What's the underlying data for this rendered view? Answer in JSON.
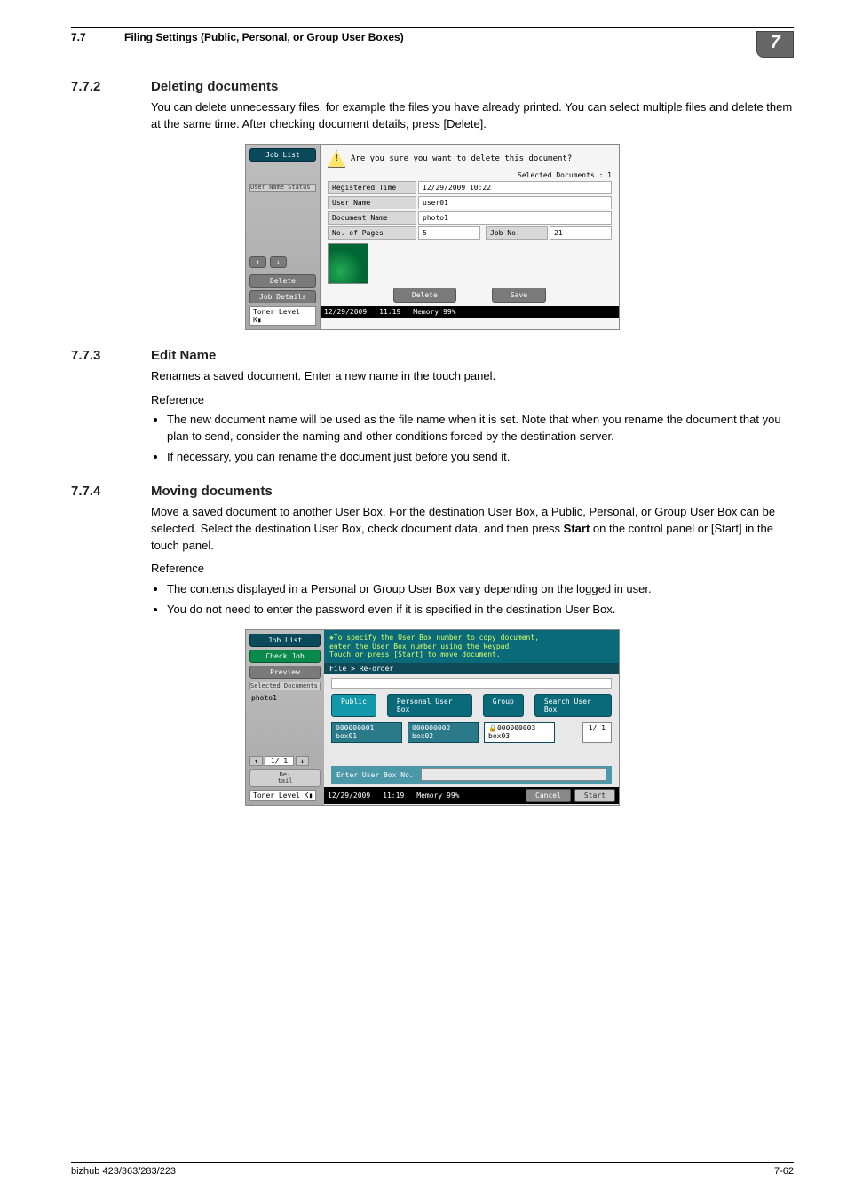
{
  "header": {
    "num": "7.7",
    "title": "Filing Settings (Public, Personal, or Group User Boxes)",
    "chapter": "7"
  },
  "s772": {
    "num": "7.7.2",
    "title": "Deleting documents",
    "para": "You can delete unnecessary files, for example the files you have already printed. You can select multiple files and delete them at the same time. After checking document details, press [Delete]."
  },
  "shot1": {
    "jobList": "Job List",
    "confirm": "Are you sure you want to delete this document?",
    "selDocsLabel": "Selected Documents",
    "selDocsVal": ":   1",
    "userStatus": "User Name   Status",
    "rows": {
      "regTimeLabel": "Registered Time",
      "regTimeVal": "12/29/2009   10:22",
      "userLabel": "User Name",
      "userVal": "user01",
      "docLabel": "Document Name",
      "docVal": "photo1",
      "pagesLabel": "No. of Pages",
      "pagesVal": "5",
      "jobNoLabel": "Job No.",
      "jobNoVal": "21"
    },
    "arrowUp": "↑",
    "arrowDown": "↓",
    "sideDelete": "Delete",
    "sideJobDetails": "Job Details",
    "btnDelete": "Delete",
    "btnSave": "Save",
    "toner": "Toner Level  K▮",
    "status": {
      "date": "12/29/2009",
      "time": "11:19",
      "memLabel": "Memory",
      "memVal": "99%"
    }
  },
  "s773": {
    "num": "7.7.3",
    "title": "Edit Name",
    "para": "Renames a saved document. Enter a new name in the touch panel.",
    "ref": "Reference",
    "b1": "The new document name will be used as the file name when it is set. Note that when you rename the document that you plan to send, consider the naming and other conditions forced by the destination server.",
    "b2": "If necessary, you can rename the document just before you send it."
  },
  "s774": {
    "num": "7.7.4",
    "title": "Moving documents",
    "para1": "Move a saved document to another User Box. For the destination User Box, a Public, Personal, or Group User Box can be selected. Select the destination User Box, check document data, and then press ",
    "paraBold": "Start",
    "para2": " on the control panel or [Start] in the touch panel.",
    "ref": "Reference",
    "b1": "The contents displayed in a Personal or Group User Box vary depending on the logged in user.",
    "b2": "You do not need to enter the password even if it is specified in the destination User Box."
  },
  "shot2": {
    "jobList": "Job List",
    "checkJob": "Check Job",
    "preview": "Preview",
    "selDocsLabel": "Selected Documents",
    "selDoc": "photo1",
    "hint1": "❖To specify the User Box number to copy document,",
    "hint2": "enter the User Box number using the keypad.",
    "hint3": "Touch or press [Start] to move document.",
    "crumb": "File > Re-order",
    "tabs": {
      "public": "Public",
      "personal": "Personal User Box",
      "group": "Group",
      "search": "Search User Box"
    },
    "boxes": [
      {
        "id": "000000001",
        "name": "box01"
      },
      {
        "id": "000000002",
        "name": "box02"
      },
      {
        "id": "000000003",
        "name": "box03",
        "locked": "🔒"
      }
    ],
    "pager": "1/ 1",
    "sidePager": "1/  1",
    "detail": "De-\ntail",
    "enterLabel": "Enter User Box No.",
    "toner": "Toner Level  K▮",
    "status": {
      "date": "12/29/2009",
      "time": "11:19",
      "memLabel": "Memory",
      "memVal": "99%"
    },
    "cancel": "Cancel",
    "start": "Start"
  },
  "footer": {
    "left": "bizhub 423/363/283/223",
    "right": "7-62"
  }
}
